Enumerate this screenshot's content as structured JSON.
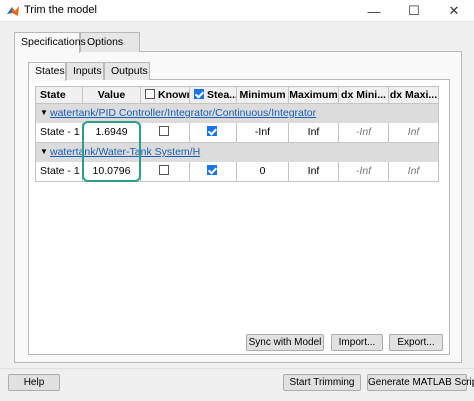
{
  "window": {
    "title": "Trim the model",
    "minimize_glyph": "—",
    "maximize_glyph": "☐",
    "close_glyph": "✕"
  },
  "outer_tabs": [
    {
      "label": "Specifications",
      "active": true
    },
    {
      "label": "Options",
      "active": false
    }
  ],
  "inner_tabs": [
    {
      "label": "States",
      "active": true
    },
    {
      "label": "Inputs",
      "active": false
    },
    {
      "label": "Outputs",
      "active": false
    }
  ],
  "table": {
    "headers": {
      "state": "State",
      "value": "Value",
      "known": "Known",
      "steady": "Stea...",
      "minimum": "Minimum",
      "maximum": "Maximum",
      "dx_min": "dx Mini...",
      "dx_max": "dx Maxi..."
    },
    "header_known_checked": false,
    "header_steady_checked": true,
    "groups": [
      {
        "arrow": "▼",
        "path": "watertank/PID Controller/Integrator/Continuous/Integrator",
        "row": {
          "state": "State - 1",
          "value": "1.6949",
          "known": false,
          "steady": true,
          "minimum": "-Inf",
          "maximum": "Inf",
          "dx_min": "-Inf",
          "dx_max": "Inf"
        }
      },
      {
        "arrow": "▼",
        "path": "watertank/Water-Tank System/H",
        "row": {
          "state": "State - 1",
          "value": "10.0796",
          "known": false,
          "steady": true,
          "minimum": "0",
          "maximum": "Inf",
          "dx_min": "-Inf",
          "dx_max": "Inf"
        }
      }
    ]
  },
  "panel_buttons": {
    "sync": "Sync with Model",
    "import": "Import...",
    "export": "Export..."
  },
  "bottom_buttons": {
    "help": "Help",
    "start": "Start Trimming",
    "generate": "Generate MATLAB Script"
  },
  "colors": {
    "link": "#1a5fb4",
    "checkbox_on": "#1a73e8",
    "highlight": "#2a9d8f"
  },
  "icons": {
    "app": "matlab-logo-icon"
  }
}
